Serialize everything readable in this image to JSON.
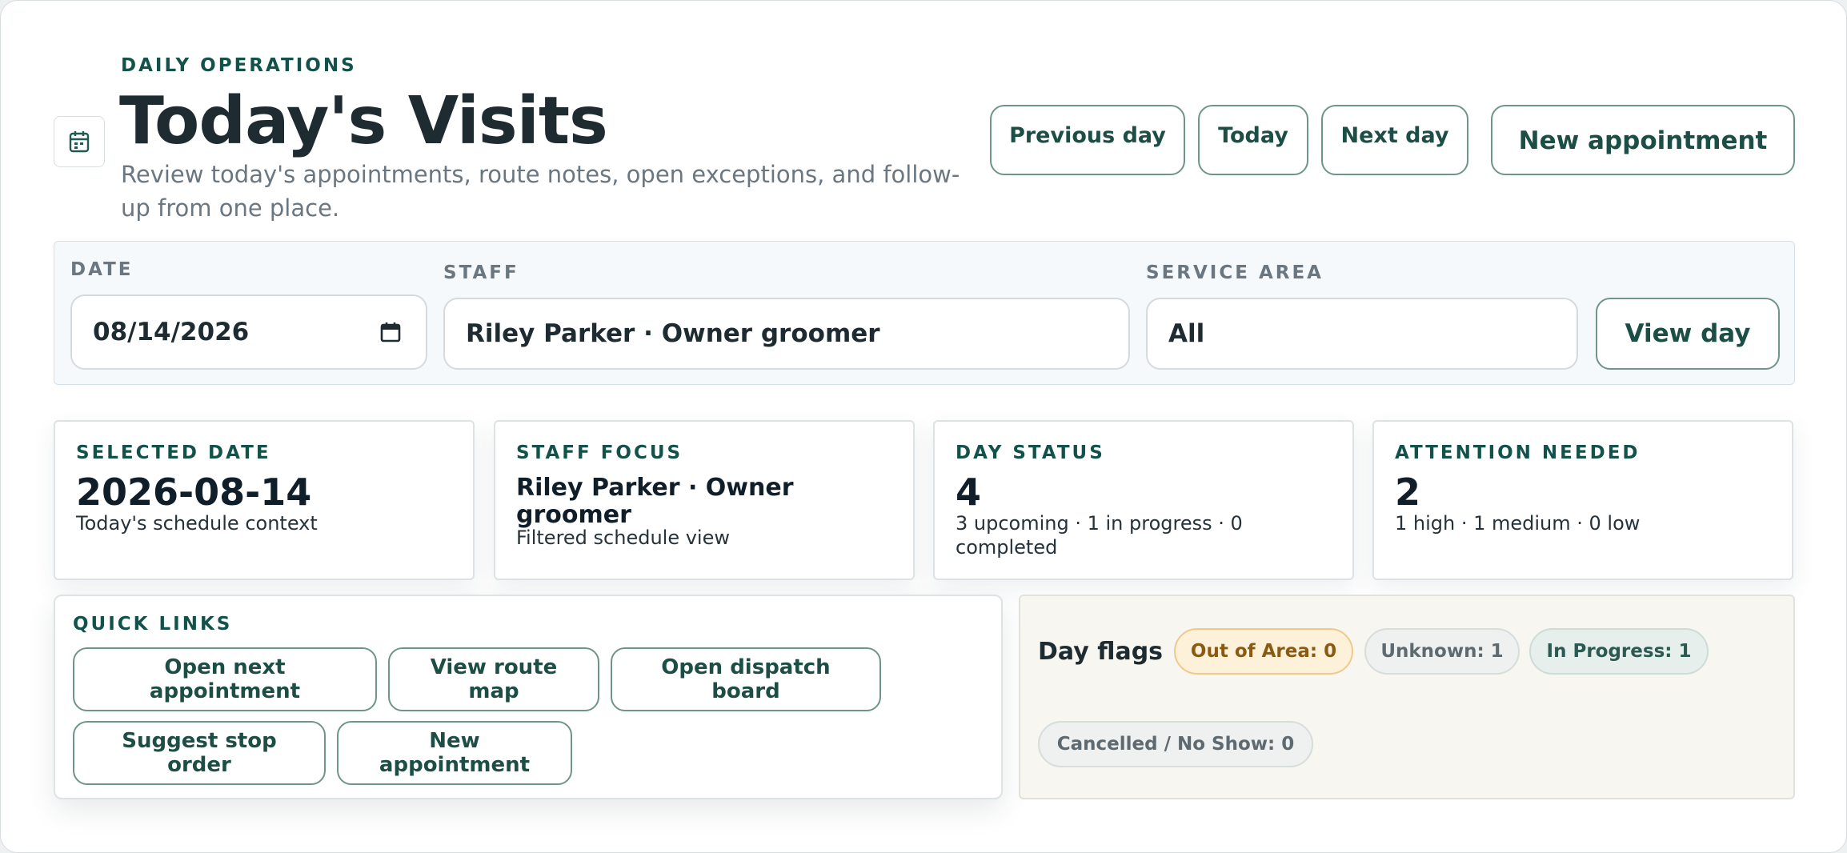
{
  "header": {
    "eyebrow": "DAILY OPERATIONS",
    "title": "Today's Visits",
    "subtitle": "Review today's appointments, route notes, open exceptions, and follow-up from one place.",
    "icon": "calendar-icon"
  },
  "actions": {
    "previous_day": "Previous day",
    "today": "Today",
    "next_day": "Next day",
    "new_appointment": "New appointment"
  },
  "filters": {
    "date_label": "DATE",
    "date_value": "08/14/2026",
    "staff_label": "STAFF",
    "staff_value": "Riley Parker · Owner groomer",
    "area_label": "SERVICE AREA",
    "area_value": "All",
    "view_day": "View day"
  },
  "stats": [
    {
      "key": "SELECTED DATE",
      "value": "2026-08-14",
      "sub": "Today's schedule context"
    },
    {
      "key": "STAFF FOCUS",
      "value": "Riley Parker · Owner groomer",
      "sub": "Filtered schedule view"
    },
    {
      "key": "DAY STATUS",
      "value": "4",
      "sub": "3 upcoming · 1 in progress · 0 completed"
    },
    {
      "key": "ATTENTION NEEDED",
      "value": "2",
      "sub": "1 high · 1 medium · 0 low"
    }
  ],
  "quick_links": {
    "heading": "QUICK LINKS",
    "items": [
      "Open next appointment",
      "View route map",
      "Open dispatch board",
      "Suggest stop order",
      "New appointment"
    ]
  },
  "day_flags": {
    "title": "Day flags",
    "pills": [
      {
        "label": "Out of Area: 0",
        "color": "#8a5a12",
        "bg": "#fdf1d9",
        "border": "#f0c98a"
      },
      {
        "label": "Unknown: 1",
        "color": "#5f6a70",
        "bg": "#eef1f0",
        "border": "#d6dddb"
      },
      {
        "label": "In Progress: 1",
        "color": "#2c5a52",
        "bg": "#e6efec",
        "border": "#cddcd7"
      },
      {
        "label": "Cancelled / No Show: 0",
        "color": "#5f6a70",
        "bg": "#eef1f0",
        "border": "#d6dddb"
      }
    ]
  },
  "colors": {
    "accent": "#12524a",
    "button_border": "#6e948c"
  }
}
